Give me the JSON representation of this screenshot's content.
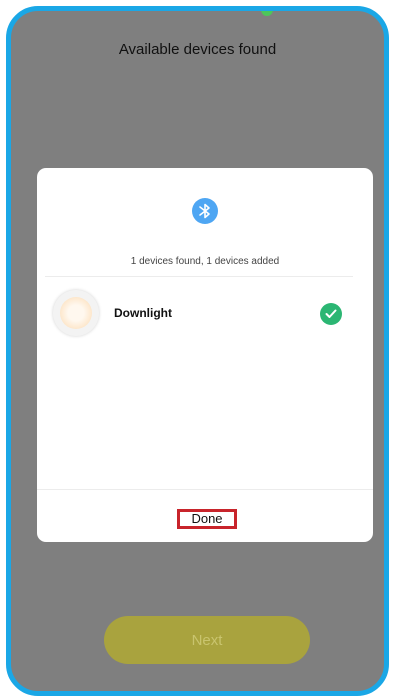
{
  "screen": {
    "title": "Available devices found",
    "next_label": "Next"
  },
  "modal": {
    "icon": "bluetooth-icon",
    "status": "1 devices found, 1 devices added",
    "devices": [
      {
        "name": "Downlight",
        "status_icon": "check-circle-icon"
      }
    ],
    "done_label": "Done"
  },
  "colors": {
    "frame_border": "#1aa7e6",
    "overlay": "#7f7f7f",
    "bluetooth": "#4ea6f3",
    "check": "#2bb673",
    "highlight": "#c8242b",
    "next_button": "#a9a33e"
  }
}
